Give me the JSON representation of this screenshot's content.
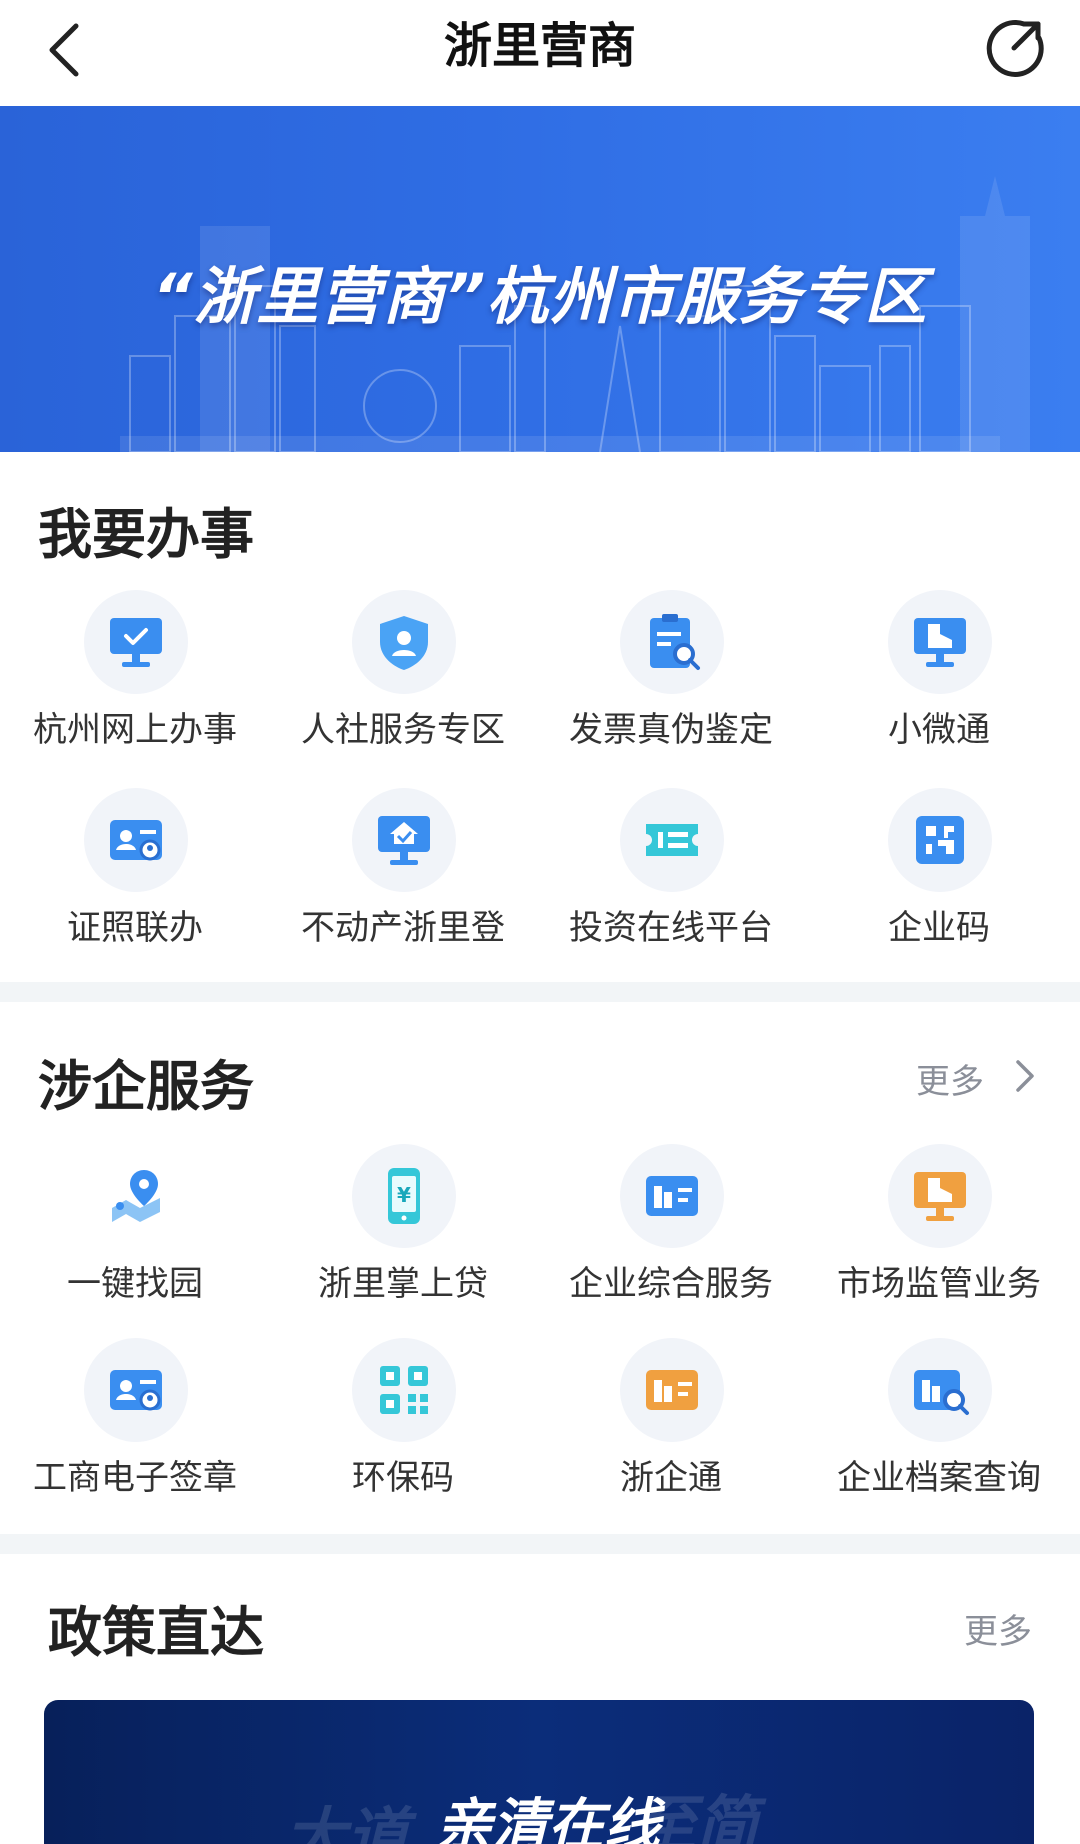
{
  "nav": {
    "title": "浙里营商",
    "back_icon": "back-chevron-icon",
    "share_icon": "share-icon"
  },
  "banner": {
    "title": "“浙里营商”杭州市服务专区"
  },
  "section1": {
    "title": "我要办事",
    "items": [
      {
        "label": "杭州网上办事",
        "icon": "computer-check-icon"
      },
      {
        "label": "人社服务专区",
        "icon": "shield-person-icon"
      },
      {
        "label": "发票真伪鉴定",
        "icon": "invoice-search-icon"
      },
      {
        "label": "小微通",
        "icon": "computer-building-icon"
      },
      {
        "label": "证照联办",
        "icon": "id-card-icon"
      },
      {
        "label": "不动产浙里登",
        "icon": "computer-house-icon"
      },
      {
        "label": "投资在线平台",
        "icon": "ticket-icon"
      },
      {
        "label": "企业码",
        "icon": "qr-scan-icon"
      }
    ]
  },
  "section2": {
    "title": "涉企服务",
    "more": "更多",
    "items": [
      {
        "label": "一键找园",
        "icon": "map-pin-icon"
      },
      {
        "label": "浙里掌上贷",
        "icon": "phone-yuan-icon"
      },
      {
        "label": "企业综合服务",
        "icon": "building-card-icon"
      },
      {
        "label": "市场监管业务",
        "icon": "computer-building-orange-icon"
      },
      {
        "label": "工商电子签章",
        "icon": "id-card-icon"
      },
      {
        "label": "环保码",
        "icon": "qr-code-icon"
      },
      {
        "label": "浙企通",
        "icon": "building-card-orange-icon"
      },
      {
        "label": "企业档案查询",
        "icon": "building-search-icon"
      }
    ]
  },
  "section3": {
    "title": "政策直达",
    "more": "更多",
    "card_text": "亲清在线",
    "card_ghost_left": "大道",
    "card_ghost_right": "至简"
  },
  "colors": {
    "banner_blue": "#2f6de4",
    "icon_blue": "#3a8ef0",
    "icon_orange": "#f0a040",
    "icon_cyan": "#35c7d8",
    "divider": "#f2f5f7"
  }
}
